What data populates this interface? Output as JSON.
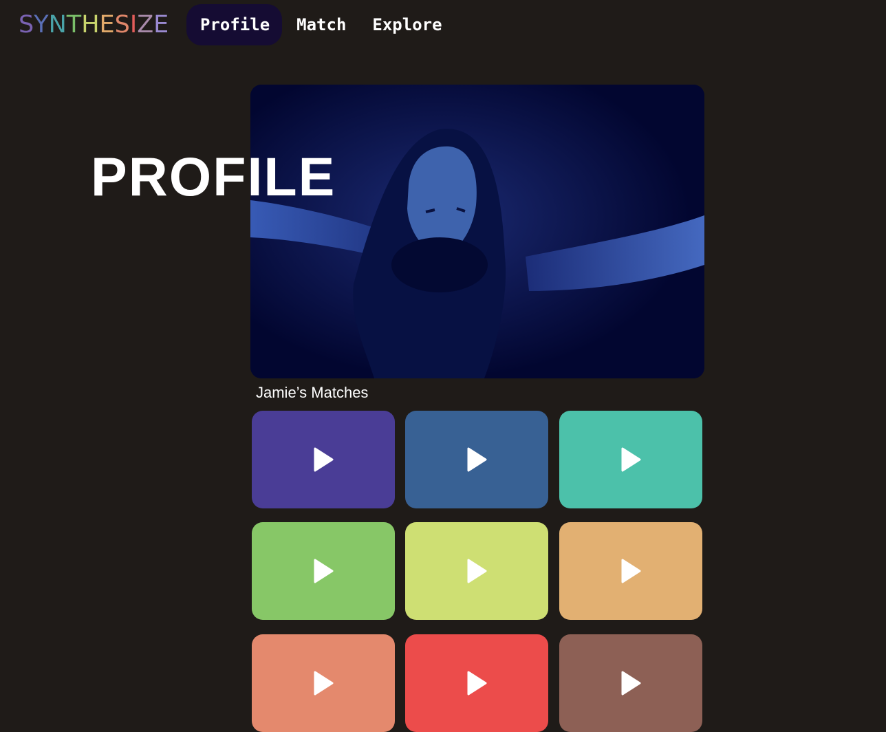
{
  "app": {
    "logo_letters": [
      "S",
      "Y",
      "N",
      "T",
      "H",
      "E",
      "S",
      "I",
      "Z",
      "E"
    ],
    "logo_colors": [
      "#7a62b2",
      "#5a6fb5",
      "#4aa3a8",
      "#7bbf6a",
      "#c9d46d",
      "#e1a96a",
      "#e0876a",
      "#e35d5a",
      "#a88aa9",
      "#9a8ad0"
    ]
  },
  "nav": {
    "items": [
      {
        "label": "Profile",
        "active": true
      },
      {
        "label": "Match",
        "active": false
      },
      {
        "label": "Explore",
        "active": false
      }
    ],
    "active_bg": "#150c33"
  },
  "hero": {
    "title": "PROFILE",
    "image_icon": "profile-video-still"
  },
  "matches": {
    "heading": "Jamie’s Matches",
    "tiles": [
      {
        "color": "#4a3d96",
        "icon": "play-icon"
      },
      {
        "color": "#386194",
        "icon": "play-icon"
      },
      {
        "color": "#4cc1aa",
        "icon": "play-icon"
      },
      {
        "color": "#87c767",
        "icon": "play-icon"
      },
      {
        "color": "#cedf73",
        "icon": "play-icon"
      },
      {
        "color": "#e2b072",
        "icon": "play-icon"
      },
      {
        "color": "#e4896d",
        "icon": "play-icon"
      },
      {
        "color": "#ec4c4b",
        "icon": "play-icon"
      },
      {
        "color": "#8d6055",
        "icon": "play-icon"
      }
    ]
  }
}
